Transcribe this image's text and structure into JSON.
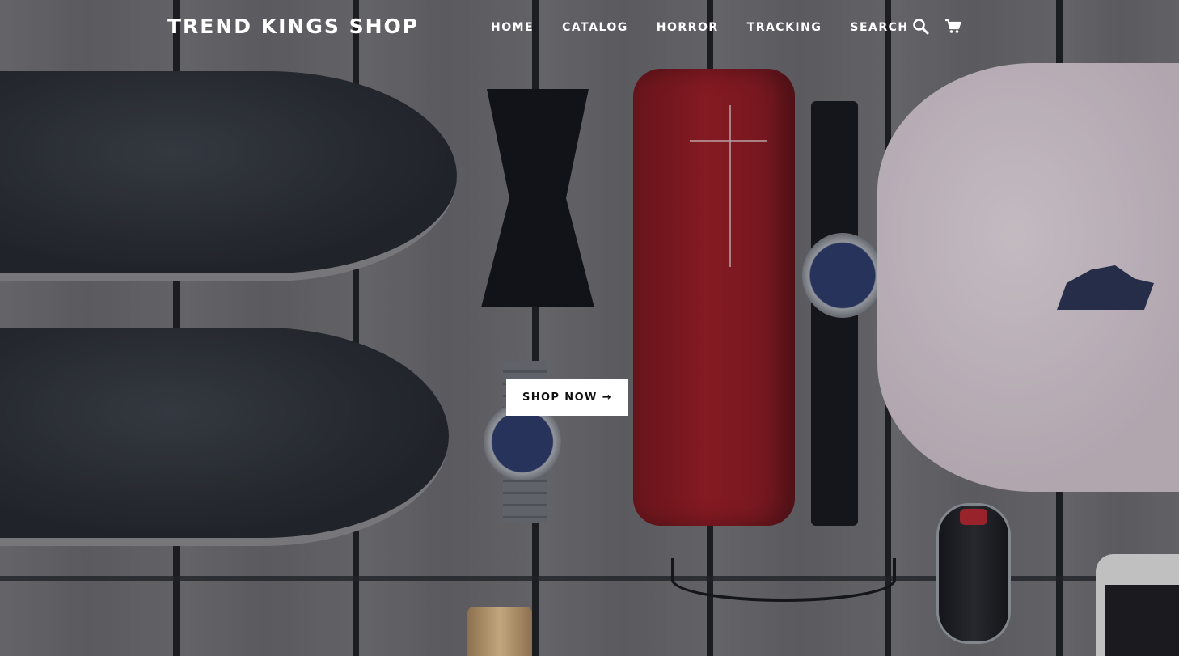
{
  "header": {
    "logo": "TREND KINGS SHOP",
    "nav": [
      "HOME",
      "CATALOG",
      "HORROR",
      "TRACKING",
      "SEARCH"
    ],
    "icons": [
      "search-icon",
      "cart-icon"
    ]
  },
  "hero": {
    "cta_label": "SHOP NOW",
    "cta_arrow": "→"
  },
  "colors": {
    "text": "#ffffff",
    "cta_background": "#ffffff",
    "cta_text": "#111111"
  }
}
